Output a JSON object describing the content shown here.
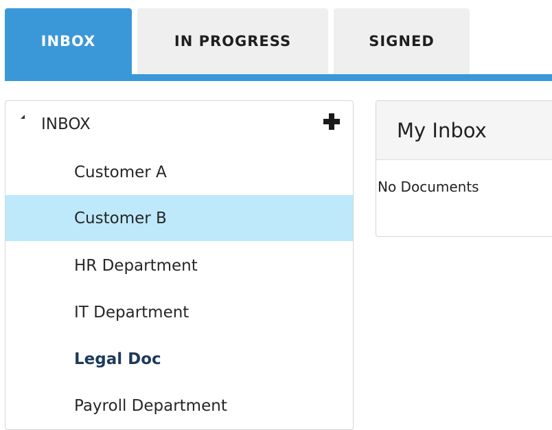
{
  "tabs": [
    {
      "label": "INBOX",
      "active": true
    },
    {
      "label": "IN PROGRESS",
      "active": false
    },
    {
      "label": "SIGNED",
      "active": false
    }
  ],
  "tree": {
    "root_label": "INBOX",
    "add_icon": "plus-icon",
    "toggle_icon": "collapse-triangle-icon",
    "items": [
      {
        "label": "Customer A",
        "selected": false,
        "bold": false
      },
      {
        "label": "Customer B",
        "selected": true,
        "bold": false
      },
      {
        "label": "HR Department",
        "selected": false,
        "bold": false
      },
      {
        "label": "IT Department",
        "selected": false,
        "bold": false
      },
      {
        "label": "Legal Doc",
        "selected": false,
        "bold": true
      },
      {
        "label": "Payroll Department",
        "selected": false,
        "bold": false
      }
    ]
  },
  "content": {
    "title": "My Inbox",
    "empty_message": "No Documents"
  },
  "colors": {
    "accent": "#3b98d8",
    "selected_row": "#bde9fb",
    "tab_inactive": "#efeff0"
  }
}
